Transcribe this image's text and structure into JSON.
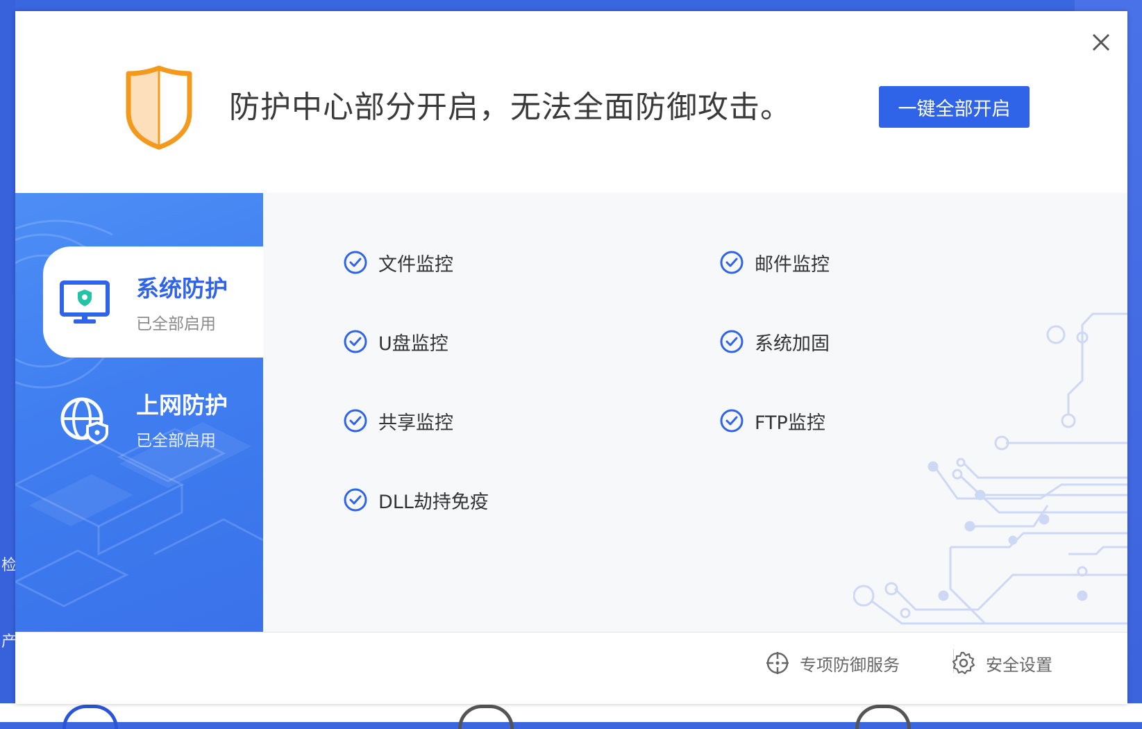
{
  "header": {
    "status_text": "防护中心部分开启，无法全面防御攻击。",
    "enable_all_button": "一键全部开启"
  },
  "sidebar": {
    "items": [
      {
        "title": "系统防护",
        "subtitle": "已全部启用",
        "active": true
      },
      {
        "title": "上网防护",
        "subtitle": "已全部启用",
        "active": false
      }
    ]
  },
  "features": [
    {
      "label": "文件监控",
      "checked": true
    },
    {
      "label": "邮件监控",
      "checked": true
    },
    {
      "label": "U盘监控",
      "checked": true
    },
    {
      "label": "系统加固",
      "checked": true
    },
    {
      "label": "共享监控",
      "checked": true
    },
    {
      "label": "FTP监控",
      "checked": true
    },
    {
      "label": "DLL劫持免疫",
      "checked": true
    }
  ],
  "footer": {
    "special_service": "专项防御服务",
    "security_settings": "安全设置"
  },
  "background": {
    "left_text_1": "检",
    "left_text_2": "产"
  },
  "colors": {
    "accent": "#2f63e8",
    "shield_orange": "#f39a1e",
    "shield_fill": "#fde0bb",
    "sidebar_blue": "#3f7ef0"
  }
}
